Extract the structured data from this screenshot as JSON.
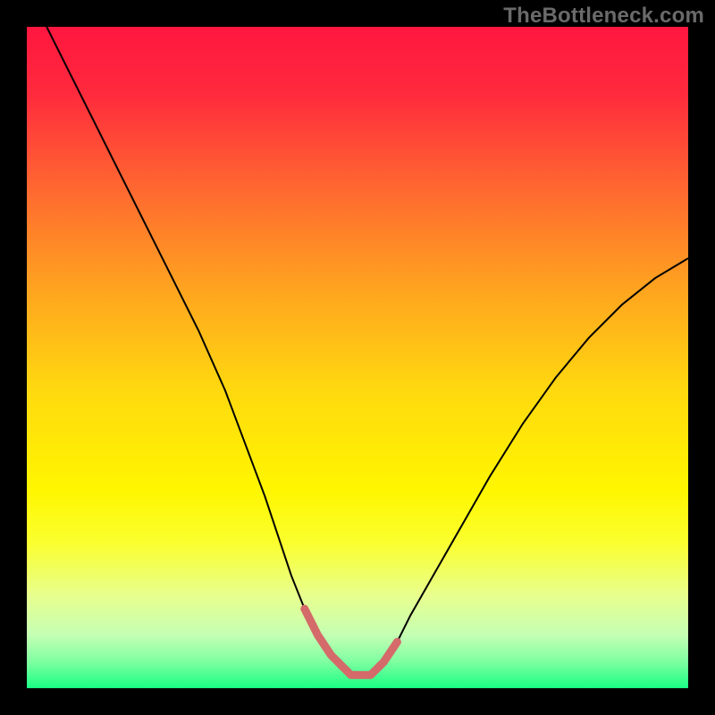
{
  "watermark": "TheBottleneck.com",
  "chart_data": {
    "type": "line",
    "title": "",
    "xlabel": "",
    "ylabel": "",
    "xlim": [
      0,
      100
    ],
    "ylim": [
      0,
      100
    ],
    "grid": false,
    "background_gradient": {
      "stops": [
        {
          "offset": 0.0,
          "color": "#ff163f"
        },
        {
          "offset": 0.1,
          "color": "#ff2a3d"
        },
        {
          "offset": 0.25,
          "color": "#ff6a30"
        },
        {
          "offset": 0.4,
          "color": "#ffa51f"
        },
        {
          "offset": 0.55,
          "color": "#ffd90f"
        },
        {
          "offset": 0.7,
          "color": "#fff600"
        },
        {
          "offset": 0.78,
          "color": "#faff2e"
        },
        {
          "offset": 0.86,
          "color": "#e8ff8e"
        },
        {
          "offset": 0.92,
          "color": "#c4ffb4"
        },
        {
          "offset": 0.96,
          "color": "#7effa0"
        },
        {
          "offset": 1.0,
          "color": "#1aff84"
        }
      ]
    },
    "series": [
      {
        "name": "bottleneck-curve",
        "stroke": "#000000",
        "stroke_width": 2,
        "x": [
          3,
          6,
          10,
          14,
          18,
          22,
          26,
          30,
          33,
          36,
          38,
          40,
          42,
          44,
          46,
          49,
          52,
          54,
          56,
          58,
          62,
          66,
          70,
          75,
          80,
          85,
          90,
          95,
          100
        ],
        "y": [
          100,
          94,
          86,
          78,
          70,
          62,
          54,
          45,
          37,
          29,
          23,
          17,
          12,
          8,
          5,
          2,
          2,
          4,
          7,
          11,
          18,
          25,
          32,
          40,
          47,
          53,
          58,
          62,
          65
        ]
      },
      {
        "name": "optimal-zone",
        "stroke": "#d46a6a",
        "stroke_width": 9,
        "linecap": "round",
        "x": [
          42,
          44,
          46,
          49,
          52,
          54,
          56
        ],
        "y": [
          12,
          8,
          5,
          2,
          2,
          4,
          7
        ]
      }
    ]
  }
}
